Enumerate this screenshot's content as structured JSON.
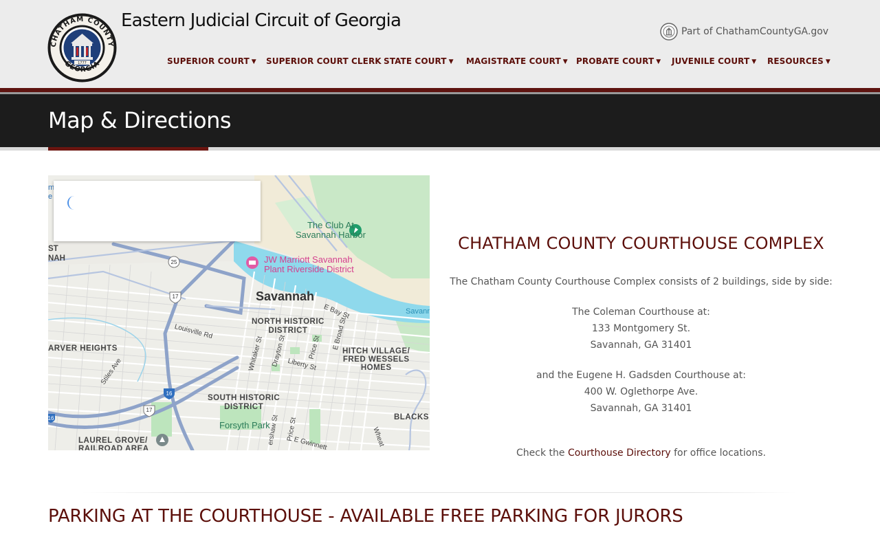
{
  "header": {
    "site_title": "Eastern Judicial Circuit of Georgia",
    "logo_top_text": "CHATHAM COUNTY",
    "logo_bottom_text": "GEORGIA",
    "logo_year": "1777",
    "part_of": "Part of ChathamCountyGA.gov"
  },
  "nav": [
    {
      "label": "SUPERIOR COURT",
      "dropdown": true
    },
    {
      "label": "SUPERIOR COURT CLERK",
      "dropdown": false
    },
    {
      "label": "STATE COURT",
      "dropdown": true
    },
    {
      "label": "MAGISTRATE COURT",
      "dropdown": true
    },
    {
      "label": "PROBATE COURT",
      "dropdown": true
    },
    {
      "label": "JUVENILE COURT",
      "dropdown": true
    },
    {
      "label": "RESOURCES",
      "dropdown": true
    }
  ],
  "banner": {
    "title": "Map & Directions"
  },
  "map": {
    "labels": {
      "city": "Savannah",
      "club_line1": "The Club At",
      "club_line2": "Savannah Harbor",
      "hotel_line1": "JW Marriott Savannah",
      "hotel_line2": "Plant Riverside District",
      "north_line1": "NORTH HISTORIC",
      "north_line2": "DISTRICT",
      "south_line1": "SOUTH HISTORIC",
      "south_line2": "DISTRICT",
      "hitch_line1": "HITCH VILLAGE/",
      "hitch_line2": "FRED WESSELS",
      "hitch_line3": "HOMES",
      "carver": "ARVER HEIGHTS",
      "laurel_line1": "LAUREL GROVE/",
      "laurel_line2": "RAILROAD AREA",
      "forsyth": "Forsyth Park",
      "blacks": "BLACKS",
      "louisville": "Louisville Rd",
      "e_bay": "E Bay St",
      "e_broad": "E Broad St",
      "price": "Price St",
      "liberty": "Liberty St",
      "whitaker": "Whitaker St",
      "drayton": "Drayton St",
      "stiles": "Stiles Ave",
      "wheaton": "Wheat",
      "abercorn": "ershaw St",
      "price2": "Price St",
      "gwinnett": "E Gwinnett",
      "savann_river": "Savann",
      "st_edge": "ST",
      "nah_edge": "NAH",
      "m_edge": "m",
      "e_edge": "e",
      "route_25": "25",
      "route_17a": "17",
      "route_17b": "17",
      "route_16a": "16",
      "route_16b": "16"
    }
  },
  "complex": {
    "title": "CHATHAM COUNTY COURTHOUSE COMPLEX",
    "intro": "The Chatham County Courthouse Complex consists of 2 buildings, side by side:",
    "coleman_line1": "The Coleman Courthouse at:",
    "coleman_line2": "133 Montgomery St.",
    "coleman_line3": "Savannah, GA 31401",
    "gadsden_line1": "and the Eugene H. Gadsden Courthouse at:",
    "gadsden_line2": "400 W. Oglethorpe Ave.",
    "gadsden_line3": "Savannah, GA 31401",
    "check_prefix": "Check the ",
    "check_link": "Courthouse Directory",
    "check_suffix": " for office locations."
  },
  "parking": {
    "title": "PARKING AT THE COURTHOUSE - AVAILABLE FREE PARKING FOR JURORS"
  },
  "colors": {
    "accent": "#5c0f0a",
    "banner_bg": "#1c1c1c",
    "header_bg": "#ececec",
    "water": "#8fd9ec",
    "park": "#c6e8c6"
  }
}
